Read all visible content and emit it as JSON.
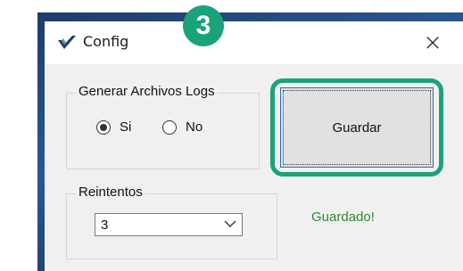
{
  "window": {
    "title": "Config",
    "close_glyph": "×",
    "app_icon": "checkmark-shield-icon"
  },
  "step_badge": {
    "number": "3",
    "color": "#1aa37a"
  },
  "logs_group": {
    "legend": "Generar Archivos Logs",
    "options": [
      {
        "label": "Si",
        "selected": true
      },
      {
        "label": "No",
        "selected": false
      }
    ]
  },
  "save_button": {
    "label": "Guardar",
    "highlight_color": "#1aa37a"
  },
  "retries_group": {
    "legend": "Reintentos",
    "selected_value": "3"
  },
  "status": {
    "text": "Guardado!",
    "color": "#2e8b2e"
  }
}
